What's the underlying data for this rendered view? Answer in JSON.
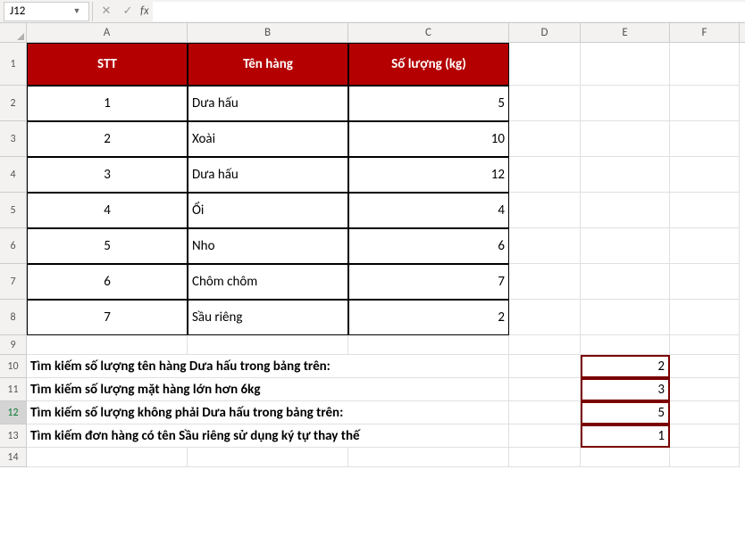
{
  "namebox": "J12",
  "fx_label": "fx",
  "columns": [
    "A",
    "B",
    "C",
    "D",
    "E",
    "F"
  ],
  "table": {
    "headers": {
      "stt": "STT",
      "name": "Tên hàng",
      "qty": "Số lượng (kg)"
    },
    "rows": [
      {
        "stt": "1",
        "name": "Dưa hấu",
        "qty": "5"
      },
      {
        "stt": "2",
        "name": "Xoài",
        "qty": "10"
      },
      {
        "stt": "3",
        "name": "Dưa hấu",
        "qty": "12"
      },
      {
        "stt": "4",
        "name": "Ổi",
        "qty": "4"
      },
      {
        "stt": "5",
        "name": "Nho",
        "qty": "6"
      },
      {
        "stt": "6",
        "name": "Chôm chôm",
        "qty": "7"
      },
      {
        "stt": "7",
        "name": "Sầu riêng",
        "qty": "2"
      }
    ]
  },
  "queries": [
    {
      "text": "Tìm kiếm số lượng tên hàng Dưa hấu trong bảng trên:",
      "result": "2"
    },
    {
      "text": "Tìm kiếm số lượng mặt hàng lớn hơn 6kg",
      "result": "3"
    },
    {
      "text": "Tìm kiếm số lượng không phải Dưa hấu trong bảng trên:",
      "result": "5"
    },
    {
      "text": "Tìm kiếm đơn hàng có tên Sầu riêng sử dụng ký tự thay thế",
      "result": "1"
    }
  ],
  "row_labels": [
    "1",
    "2",
    "3",
    "4",
    "5",
    "6",
    "7",
    "8",
    "9",
    "10",
    "11",
    "12",
    "13",
    "14"
  ]
}
